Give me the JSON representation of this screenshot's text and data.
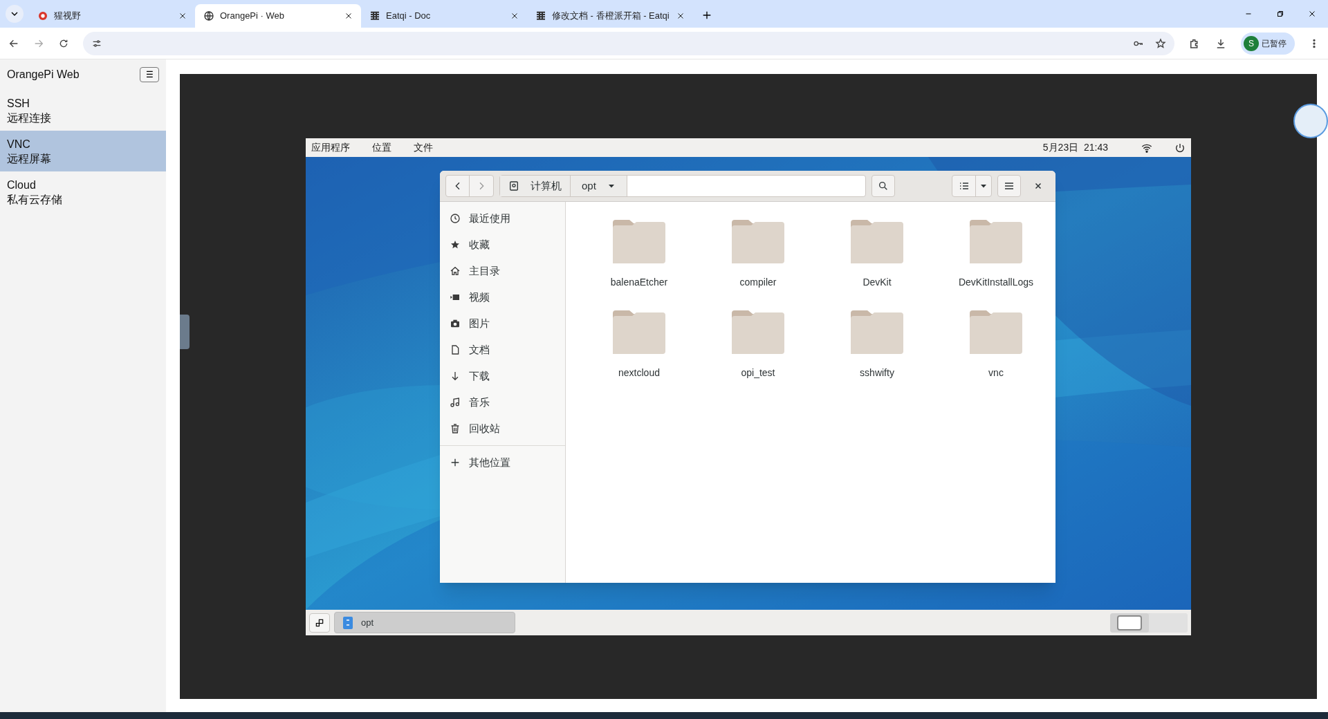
{
  "browser": {
    "tabs": [
      {
        "title": "猩视野",
        "selected": false,
        "kind": "red"
      },
      {
        "title": "OrangePi · Web",
        "selected": true,
        "kind": "globe"
      },
      {
        "title": "Eatqi - Doc",
        "selected": false,
        "kind": "grid"
      },
      {
        "title": "修改文档 - 香橙派开箱 - Eatqi",
        "selected": false,
        "kind": "grid"
      }
    ],
    "profile": {
      "initial": "S",
      "label": "已暂停"
    }
  },
  "app": {
    "title": "OrangePi Web",
    "menu_button": "☰",
    "nav": [
      {
        "name": "SSH",
        "desc": "远程连接",
        "selected": false
      },
      {
        "name": "VNC",
        "desc": "远程屏幕",
        "selected": true
      },
      {
        "name": "Cloud",
        "desc": "私有云存储",
        "selected": false
      }
    ]
  },
  "desktop": {
    "top_menu": [
      "应用程序",
      "位置",
      "文件"
    ],
    "clock": "5月23日  21:43",
    "file_manager": {
      "path": [
        {
          "label": "计算机",
          "kind": "drive"
        },
        {
          "label": "opt",
          "kind": "current"
        }
      ],
      "places": [
        {
          "label": "最近使用",
          "kind": "clock"
        },
        {
          "label": "收藏",
          "kind": "star"
        },
        {
          "label": "主目录",
          "kind": "home"
        },
        {
          "label": "视频",
          "kind": "video"
        },
        {
          "label": "图片",
          "kind": "camera"
        },
        {
          "label": "文档",
          "kind": "doc"
        },
        {
          "label": "下载",
          "kind": "down"
        },
        {
          "label": "音乐",
          "kind": "music"
        },
        {
          "label": "回收站",
          "kind": "trash"
        }
      ],
      "other_places": "其他位置",
      "folders": [
        "balenaEtcher",
        "compiler",
        "DevKit",
        "DevKitInstallLogs",
        "nextcloud",
        "opi_test",
        "sshwifty",
        "vnc"
      ]
    },
    "taskbar": {
      "window": "opt",
      "workspaces": [
        {
          "selected": true
        },
        {
          "selected": false
        }
      ]
    }
  }
}
